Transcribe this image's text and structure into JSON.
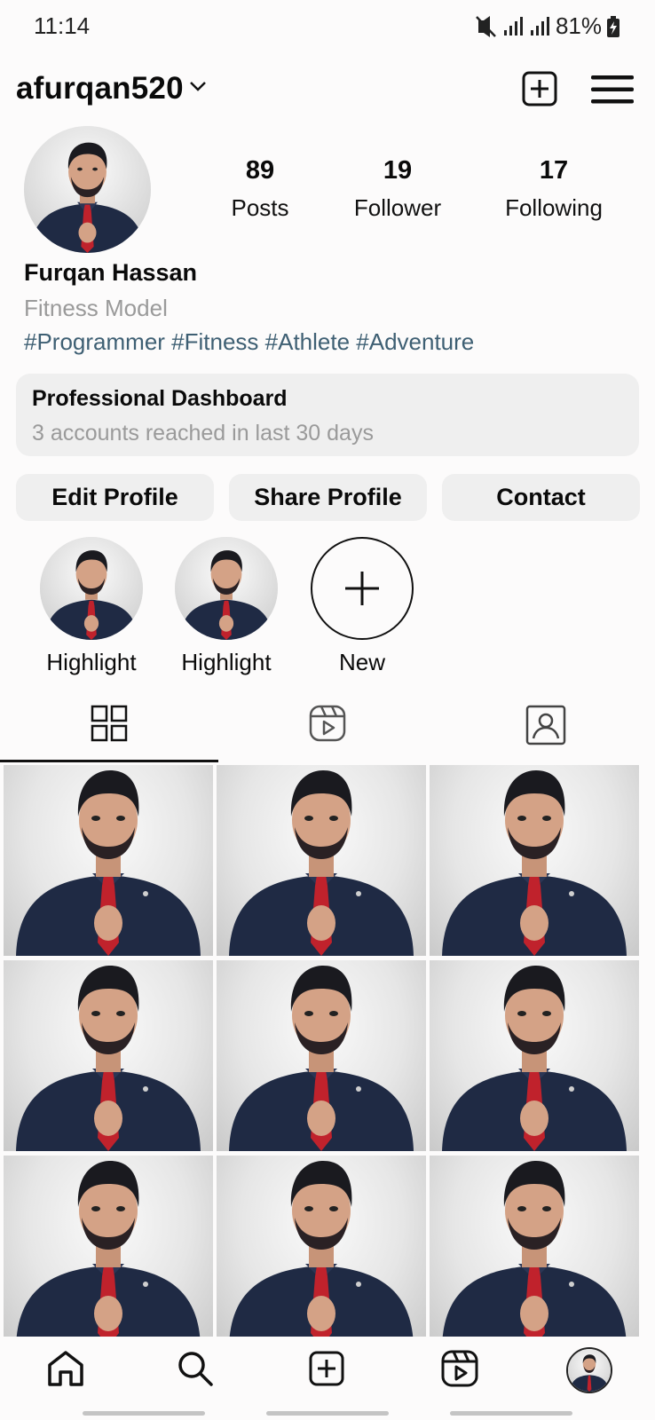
{
  "status_bar": {
    "time": "11:14",
    "battery": "81%",
    "icons": [
      "mute-vibrate-icon",
      "signal-icon",
      "signal-icon",
      "battery-charging-icon"
    ]
  },
  "header": {
    "username": "afurqan520",
    "icons": [
      "chevron-down-icon",
      "add-post-icon",
      "menu-icon"
    ]
  },
  "profile": {
    "stats": [
      {
        "value": "89",
        "label": "Posts"
      },
      {
        "value": "19",
        "label": "Follower"
      },
      {
        "value": "17",
        "label": "Following"
      }
    ],
    "display_name": "Furqan Hassan",
    "category": "Fitness Model",
    "bio": "#Programmer #Fitness #Athlete #Adventure"
  },
  "dashboard": {
    "title": "Professional Dashboard",
    "subtitle": "3 accounts reached in last 30 days"
  },
  "actions": {
    "edit": "Edit Profile",
    "share": "Share Profile",
    "contact": "Contact"
  },
  "highlights": [
    {
      "label": "Highlight"
    },
    {
      "label": "Highlight"
    },
    {
      "label": "New"
    }
  ],
  "tabs": {
    "icons": [
      "grid-icon",
      "reels-icon",
      "tagged-icon"
    ],
    "active": "grid-icon"
  },
  "posts": {
    "count_visible": 9
  },
  "bottom_nav": {
    "icons": [
      "home-icon",
      "search-icon",
      "create-icon",
      "reels-icon",
      "profile-avatar"
    ]
  },
  "colors": {
    "background": "#fcfbfb",
    "button_bg": "#efefef",
    "hashtag": "#3e5f73",
    "secondary_text": "#9a9a9a",
    "shirt": "#1f2a44",
    "tie": "#c0222c"
  }
}
